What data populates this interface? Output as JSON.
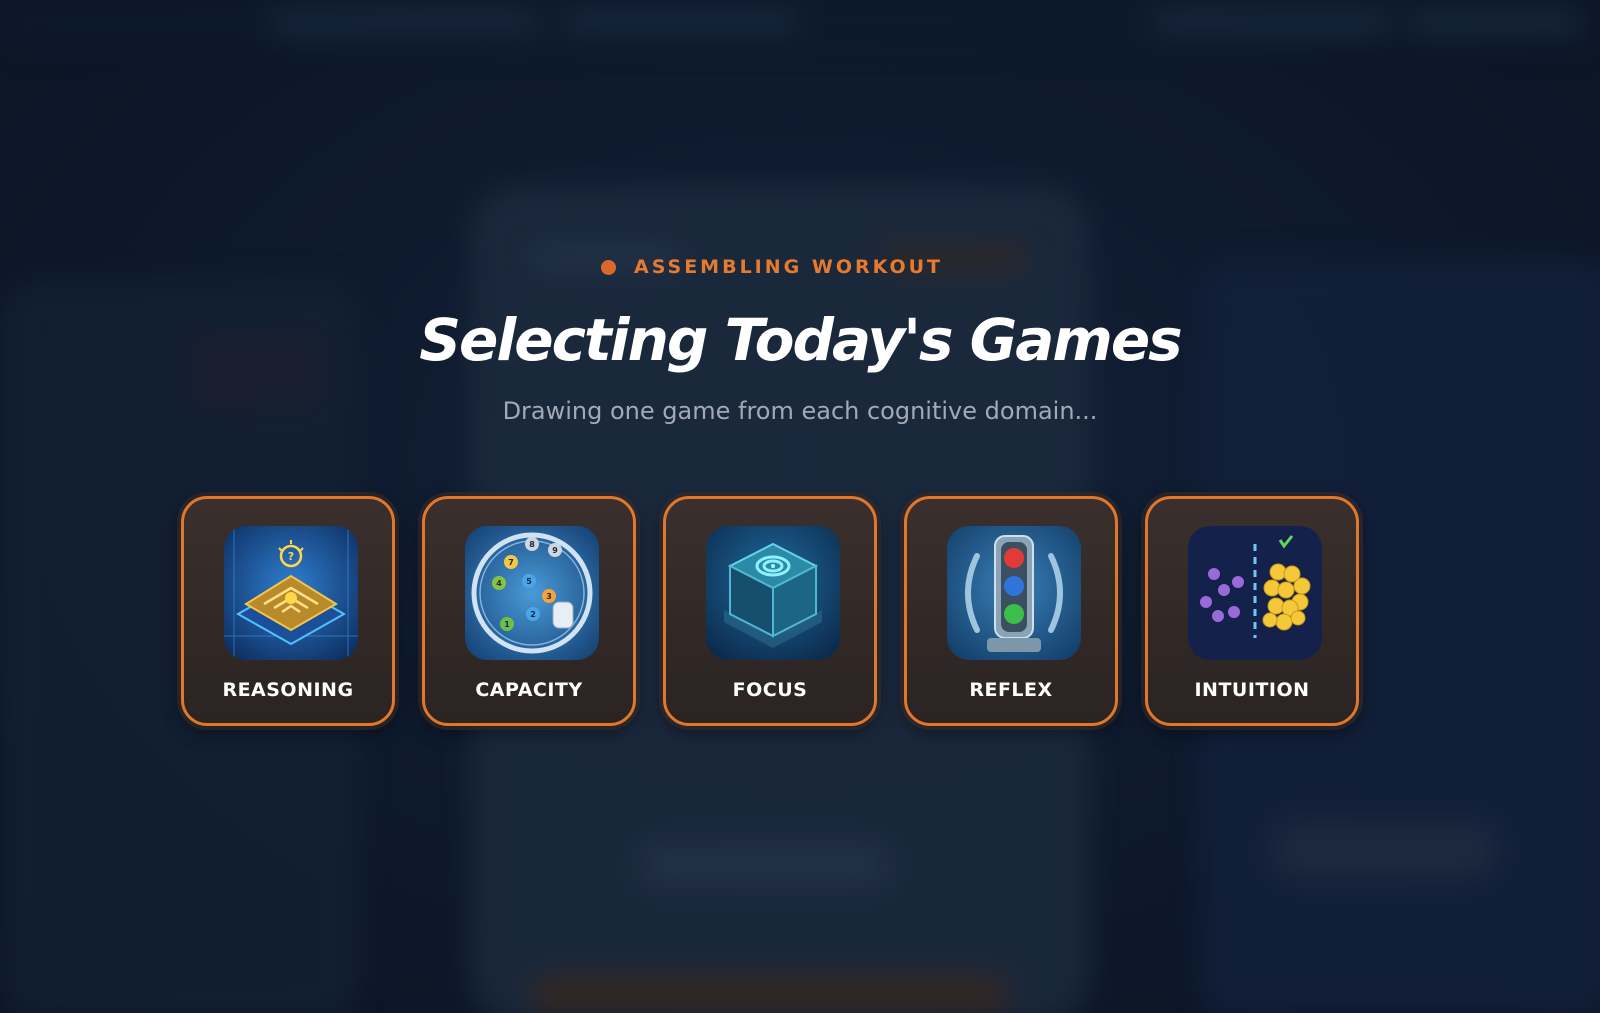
{
  "status": {
    "label": "ASSEMBLING WORKOUT",
    "dot_color": "#d9692a",
    "text_color": "#e87a2e"
  },
  "title": "Selecting Today's Games",
  "subtitle": "Drawing one game from each cognitive domain...",
  "accent_color": "#e0772a",
  "domains": [
    {
      "label": "REASONING",
      "icon": "maze-icon"
    },
    {
      "label": "CAPACITY",
      "icon": "number-sequence-icon"
    },
    {
      "label": "FOCUS",
      "icon": "spiral-cube-icon"
    },
    {
      "label": "REFLEX",
      "icon": "traffic-light-icon"
    },
    {
      "label": "INTUITION",
      "icon": "sorting-creatures-stars-icon"
    }
  ]
}
